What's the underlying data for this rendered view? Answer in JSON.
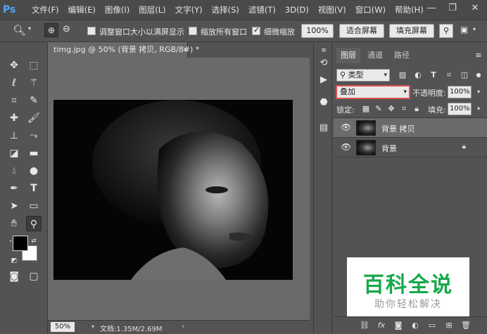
{
  "app": {
    "logo": "Ps"
  },
  "menu": [
    "文件(F)",
    "编辑(E)",
    "图像(I)",
    "图层(L)",
    "文字(Y)",
    "选择(S)",
    "滤镜(T)",
    "3D(D)",
    "视图(V)",
    "窗口(W)",
    "帮助(H)"
  ],
  "window_controls": [
    "—",
    "❐",
    "✕"
  ],
  "options": {
    "resize_windows_label": "调整窗口大小以满屏显示",
    "resize_windows_checked": false,
    "zoom_all_label": "缩放所有窗口",
    "zoom_all_checked": false,
    "scrubby_zoom_label": "细微缩放",
    "scrubby_zoom_checked": true,
    "zoom_value": "100%",
    "fit_screen_label": "适合屏幕",
    "fill_screen_label": "填充屏幕"
  },
  "document": {
    "tab_title": "timg.jpg @ 50% (背景 拷贝, RGB/8#) *",
    "close_glyph": "×",
    "status_zoom": "50%",
    "status_info": "文档:1.35M/2.69M"
  },
  "layers_panel": {
    "tabs": [
      "图层",
      "通道",
      "路径"
    ],
    "active_tab": 0,
    "filter_kind": "类型",
    "blend_mode": "叠加",
    "opacity_label": "不透明度:",
    "opacity_value": "100%",
    "lock_label": "锁定:",
    "fill_label": "填充:",
    "fill_value": "100%",
    "layers": [
      {
        "name": "背景 拷贝",
        "selected": true,
        "locked": false
      },
      {
        "name": "背景",
        "selected": false,
        "locked": true
      }
    ]
  },
  "watermark": {
    "title": "百科全说",
    "subtitle": "助你轻松解决",
    "title_color": "#16a84a"
  },
  "colors": {
    "foreground": "#000000",
    "background": "#ffffff",
    "highlight_border": "#d9534f"
  }
}
